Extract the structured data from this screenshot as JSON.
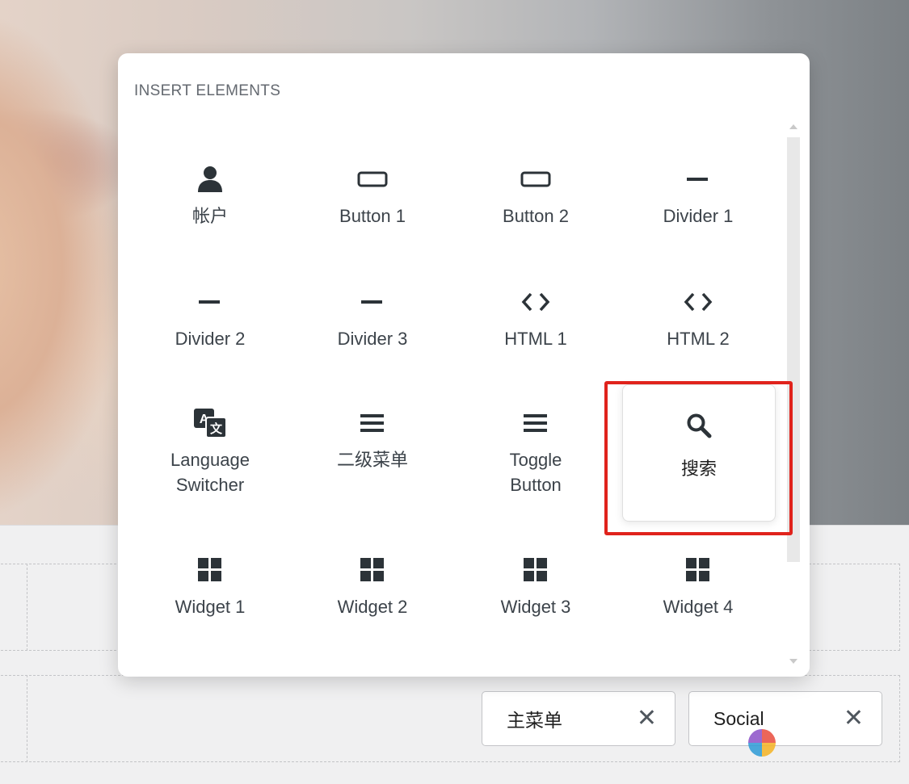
{
  "popup": {
    "title": "INSERT ELEMENTS",
    "elements": [
      {
        "label": "帐户",
        "icon": "user-icon"
      },
      {
        "label": "Button 1",
        "icon": "button-icon"
      },
      {
        "label": "Button 2",
        "icon": "button-icon"
      },
      {
        "label": "Divider 1",
        "icon": "divider-icon"
      },
      {
        "label": "Divider 2",
        "icon": "divider-icon"
      },
      {
        "label": "Divider 3",
        "icon": "divider-icon"
      },
      {
        "label": "HTML 1",
        "icon": "code-icon"
      },
      {
        "label": "HTML 2",
        "icon": "code-icon"
      },
      {
        "label": "Language\nSwitcher",
        "icon": "translate-icon"
      },
      {
        "label": "二级菜单",
        "icon": "menu-icon"
      },
      {
        "label": "Toggle\nButton",
        "icon": "menu-icon"
      },
      {
        "label": "搜索",
        "icon": "search-icon",
        "selected": true
      },
      {
        "label": "Widget 1",
        "icon": "widget-grid-icon"
      },
      {
        "label": "Widget 2",
        "icon": "widget-grid-icon"
      },
      {
        "label": "Widget 3",
        "icon": "widget-grid-icon"
      },
      {
        "label": "Widget 4",
        "icon": "widget-grid-icon"
      }
    ]
  },
  "builder_row": {
    "chips": [
      {
        "label": "主菜单",
        "remove": "✕"
      },
      {
        "label": "Social",
        "remove": "✕"
      }
    ]
  },
  "colors": {
    "highlight": "#e0231c",
    "icon": "#2c3338"
  }
}
